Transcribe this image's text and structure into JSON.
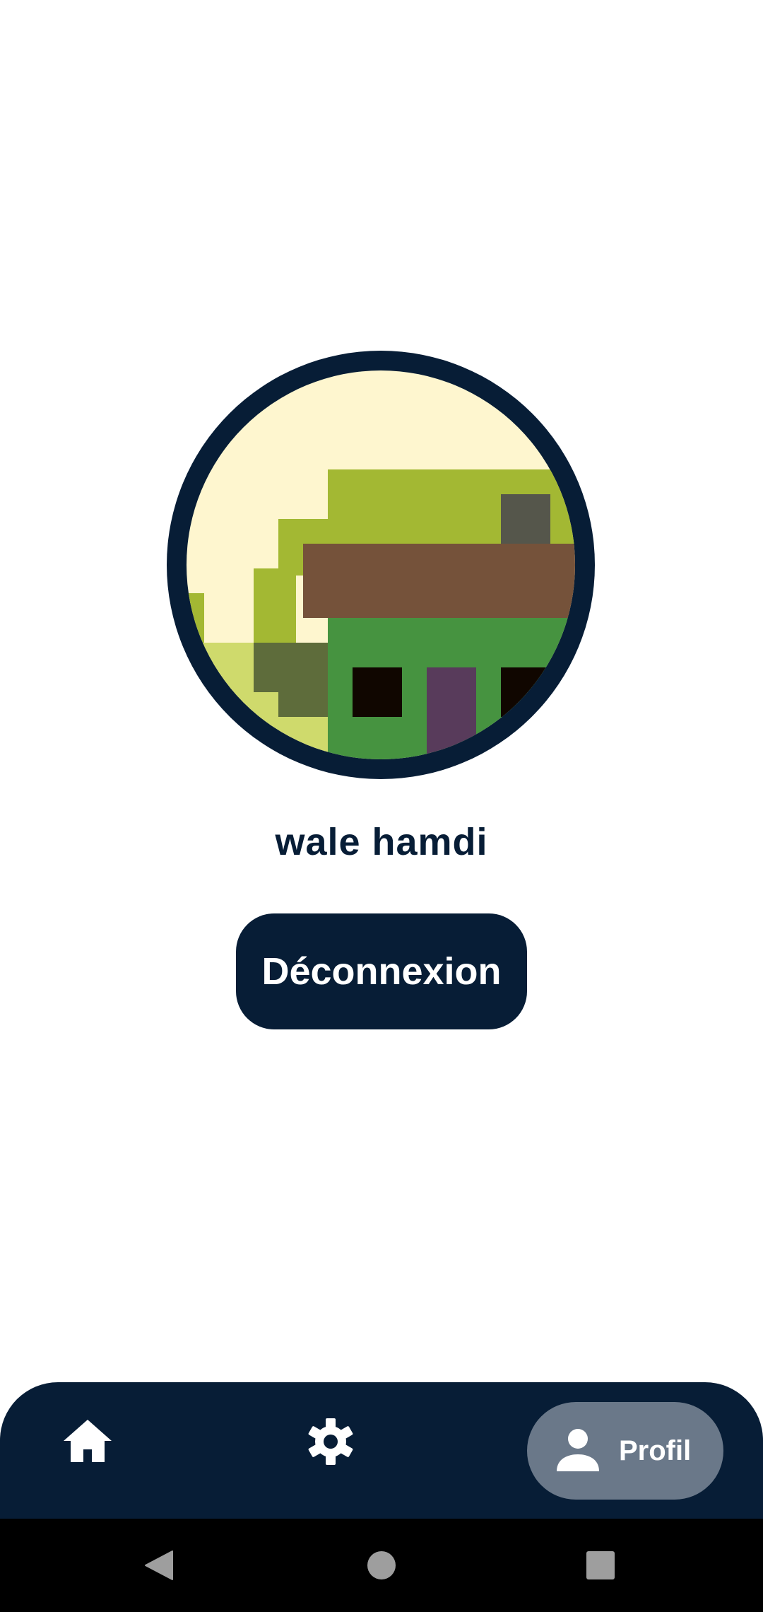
{
  "profile": {
    "user_name": "wale hamdi",
    "avatar_icon": "pixel-art-house-avatar"
  },
  "actions": {
    "logout_label": "Déconnexion"
  },
  "bottom_nav": {
    "items": [
      {
        "id": "home",
        "icon": "home-icon",
        "label": ""
      },
      {
        "id": "settings",
        "icon": "gear-icon",
        "label": ""
      },
      {
        "id": "profile",
        "icon": "person-icon",
        "label": "Profil",
        "selected": true
      }
    ]
  },
  "system_nav": {
    "buttons": [
      "back-icon",
      "home-circle-icon",
      "recents-icon"
    ]
  },
  "colors": {
    "primary": "#071d36",
    "selected_pill": "#6a7889",
    "background": "#ffffff"
  }
}
